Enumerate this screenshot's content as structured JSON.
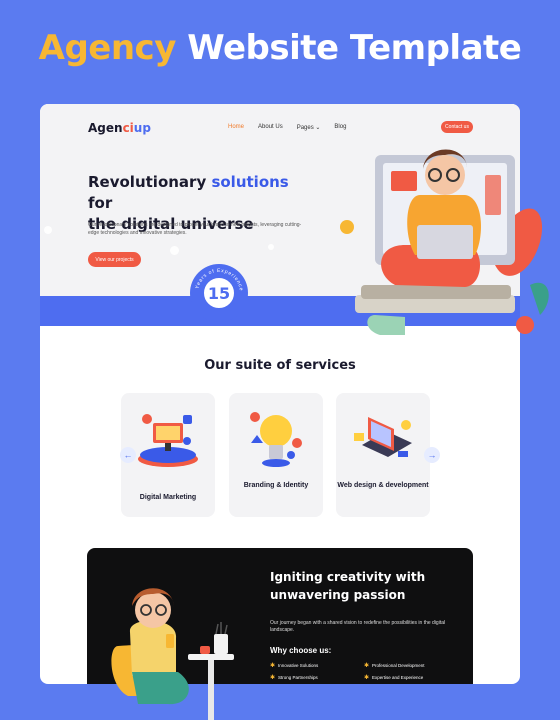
{
  "promo": {
    "title_accent": "Agency",
    "title_rest": "Website Template"
  },
  "header": {
    "logo_part1": "Agen",
    "logo_part2": "ci",
    "logo_part3": "up",
    "nav": [
      "Home",
      "About Us",
      "Pages",
      "Blog"
    ],
    "pages_caret": "⌄",
    "contact_label": "Contact us"
  },
  "hero": {
    "title_line1_a": "Revolutionary ",
    "title_line1_b": "solutions",
    "title_line1_c": " for",
    "title_line2": "the digital universe",
    "description": "Our revolutionary solutions are designed to propel your brand to new heights, leveraging cutting-edge technologies and innovative strategies.",
    "cta_label": "View our projects",
    "experience_years": "15",
    "experience_caption": "Years of Experience"
  },
  "services": {
    "title": "Our suite of services",
    "cards": [
      {
        "label": "Digital Marketing"
      },
      {
        "label": "Branding & Identity"
      },
      {
        "label": "Web design & development"
      }
    ],
    "prev_icon": "←",
    "next_icon": "→"
  },
  "about": {
    "title": "Igniting creativity with unwavering passion",
    "description": "Our journey began with a shared vision to redefine the possibilities in the digital landscape.",
    "why_title": "Why choose us:",
    "bullets": [
      "Innovative Solutions",
      "Professional Development",
      "Strong Partnerships",
      "Expertise and Experience"
    ]
  },
  "colors": {
    "background": "#5b7bf0",
    "accent_yellow": "#f7b733",
    "primary_blue": "#4e6df0",
    "cta_red": "#f05a44",
    "dark_section": "#0f0f10"
  }
}
